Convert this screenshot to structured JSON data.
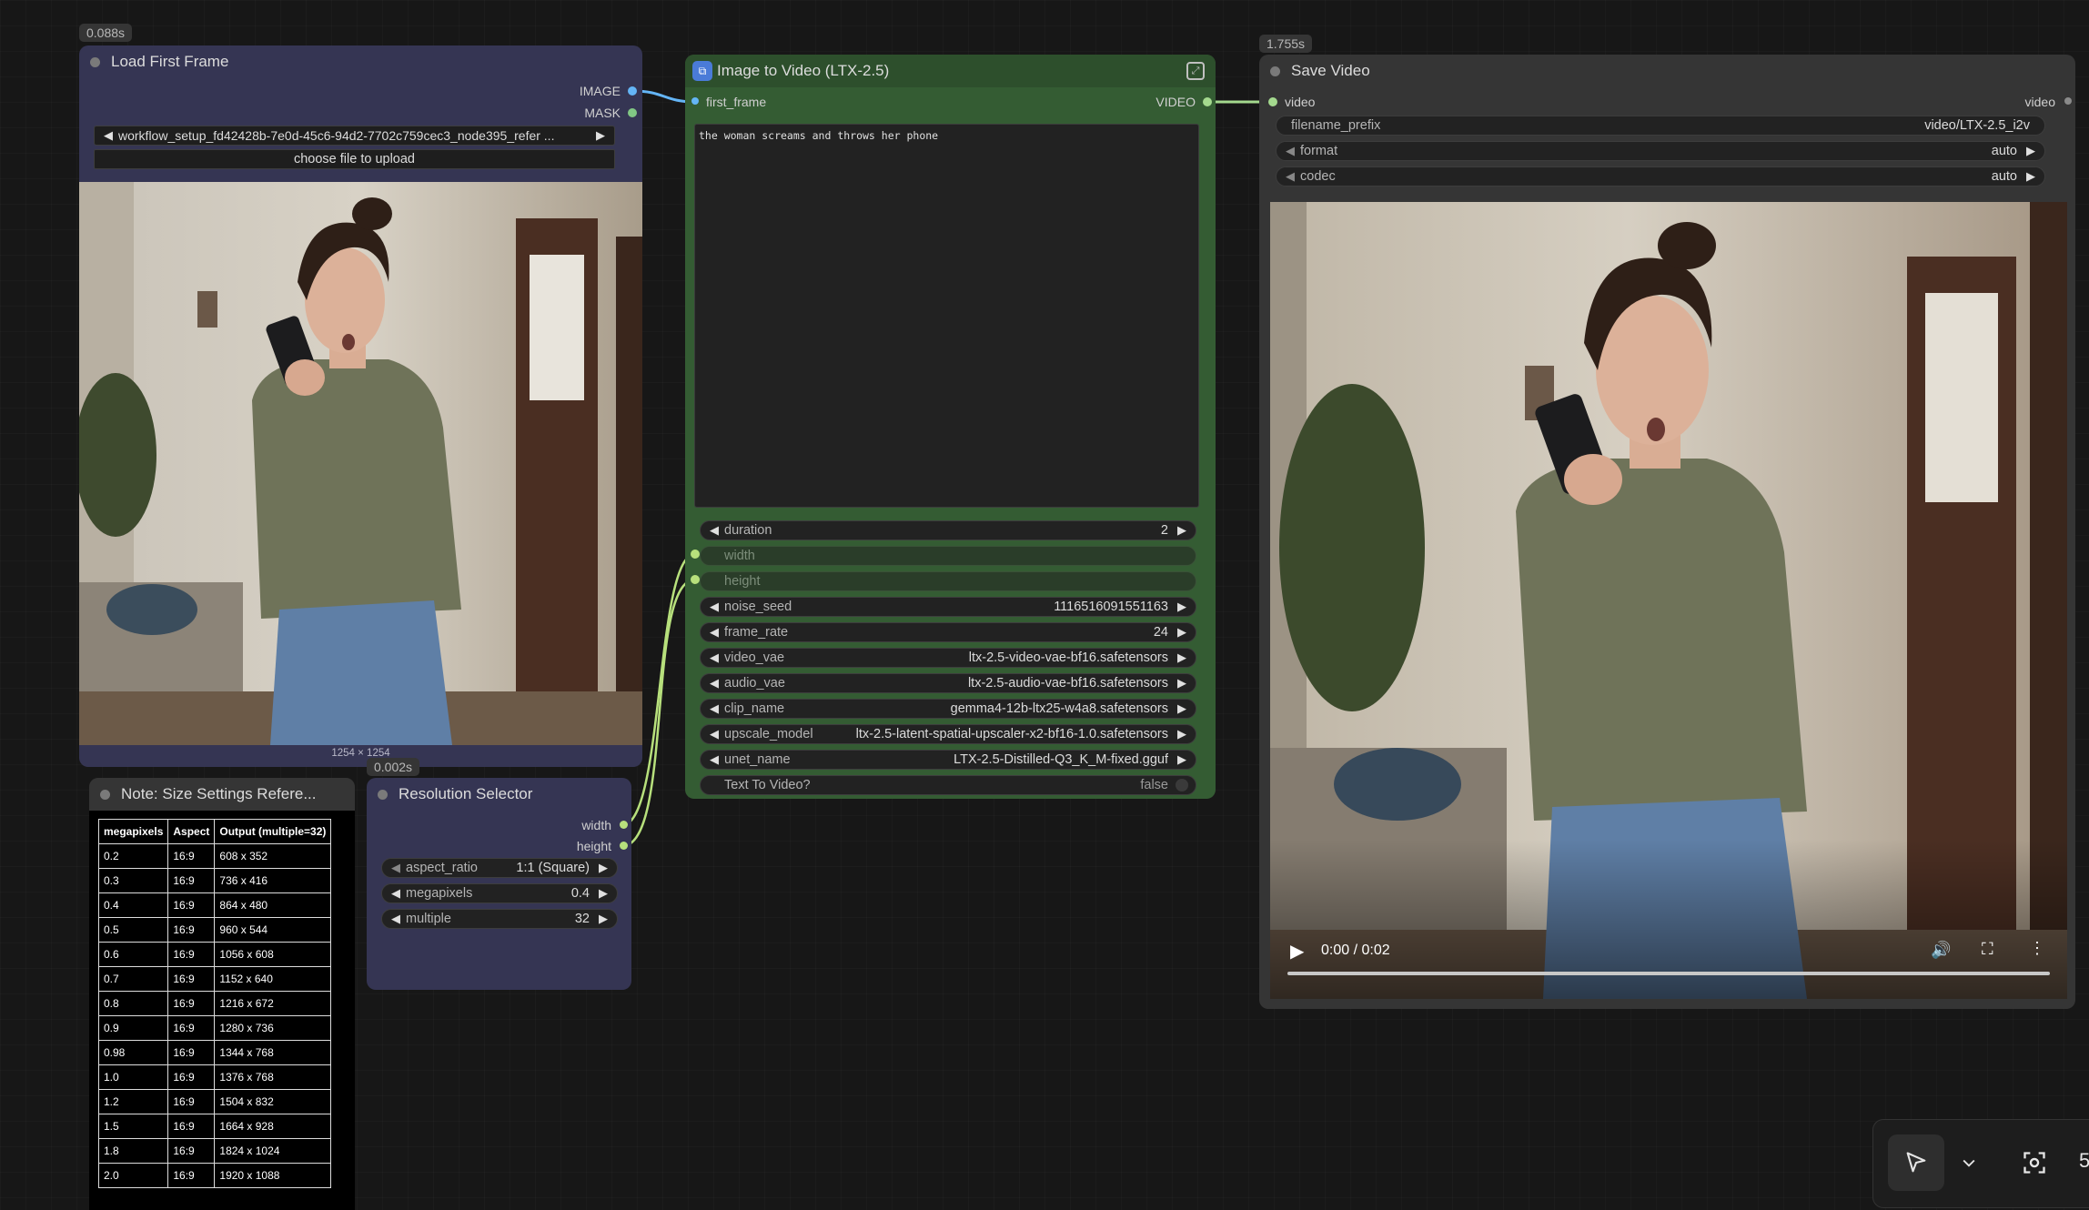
{
  "load_first_frame": {
    "timing": "0.088s",
    "title": "Load First Frame",
    "out_image": "IMAGE",
    "out_mask": "MASK",
    "file_value": "workflow_setup_fd42428b-7e0d-45c6-94d2-7702c759cec3_node395_refer ...",
    "upload_label": "choose file to upload",
    "image_size": "1254 × 1254"
  },
  "image_to_video": {
    "title": "Image to Video (LTX-2.5)",
    "in_first_frame": "first_frame",
    "out_video": "VIDEO",
    "prompt": "the woman screams and throws her phone",
    "widgets": [
      {
        "name": "duration",
        "value": "2"
      },
      {
        "name": "width",
        "value": ""
      },
      {
        "name": "height",
        "value": ""
      },
      {
        "name": "noise_seed",
        "value": "1116516091551163"
      },
      {
        "name": "frame_rate",
        "value": "24"
      },
      {
        "name": "video_vae",
        "value": "ltx-2.5-video-vae-bf16.safetensors"
      },
      {
        "name": "audio_vae",
        "value": "ltx-2.5-audio-vae-bf16.safetensors"
      },
      {
        "name": "clip_name",
        "value": "gemma4-12b-ltx25-w4a8.safetensors"
      },
      {
        "name": "upscale_model",
        "value": "ltx-2.5-latent-spatial-upscaler-x2-bf16-1.0.safetensors"
      },
      {
        "name": "unet_name",
        "value": "LTX-2.5-Distilled-Q3_K_M-fixed.gguf"
      },
      {
        "name": "Text To Video?",
        "value": "false"
      }
    ]
  },
  "save_video": {
    "timing": "1.755s",
    "title": "Save Video",
    "in_video": "video",
    "out_video": "video",
    "filename_prefix": {
      "name": "filename_prefix",
      "value": "video/LTX-2.5_i2v"
    },
    "format": {
      "name": "format",
      "value": "auto"
    },
    "codec": {
      "name": "codec",
      "value": "auto"
    },
    "player_time": "0:00 / 0:02"
  },
  "note": {
    "title": "Note: Size Settings Refere...",
    "headers": [
      "megapixels",
      "Aspect",
      "Output (multiple=32)"
    ],
    "rows": [
      [
        "0.2",
        "16:9",
        "608 x 352"
      ],
      [
        "0.3",
        "16:9",
        "736 x 416"
      ],
      [
        "0.4",
        "16:9",
        "864 x 480"
      ],
      [
        "0.5",
        "16:9",
        "960 x 544"
      ],
      [
        "0.6",
        "16:9",
        "1056 x 608"
      ],
      [
        "0.7",
        "16:9",
        "1152 x 640"
      ],
      [
        "0.8",
        "16:9",
        "1216 x 672"
      ],
      [
        "0.9",
        "16:9",
        "1280 x 736"
      ],
      [
        "0.98",
        "16:9",
        "1344 x 768"
      ],
      [
        "1.0",
        "16:9",
        "1376 x 768"
      ],
      [
        "1.2",
        "16:9",
        "1504 x 832"
      ],
      [
        "1.5",
        "16:9",
        "1664 x 928"
      ],
      [
        "1.8",
        "16:9",
        "1824 x 1024"
      ],
      [
        "2.0",
        "16:9",
        "1920 x 1088"
      ]
    ]
  },
  "resolution_selector": {
    "timing": "0.002s",
    "title": "Resolution Selector",
    "out_width": "width",
    "out_height": "height",
    "aspect_ratio": {
      "name": "aspect_ratio",
      "value": "1:1 (Square)"
    },
    "megapixels": {
      "name": "megapixels",
      "value": "0.4"
    },
    "multiple": {
      "name": "multiple",
      "value": "32"
    }
  },
  "colors": {
    "image_link": "#64b5f6",
    "video_link": "#a4d98e",
    "int_link": "#b7e07c",
    "node_purple": "#353553",
    "node_green": "#345c33",
    "node_dark": "#353535"
  },
  "toolbar": {
    "icons": [
      "pointer-icon",
      "chevron-down-icon",
      "fit-view-icon"
    ],
    "partial_text": "5"
  }
}
